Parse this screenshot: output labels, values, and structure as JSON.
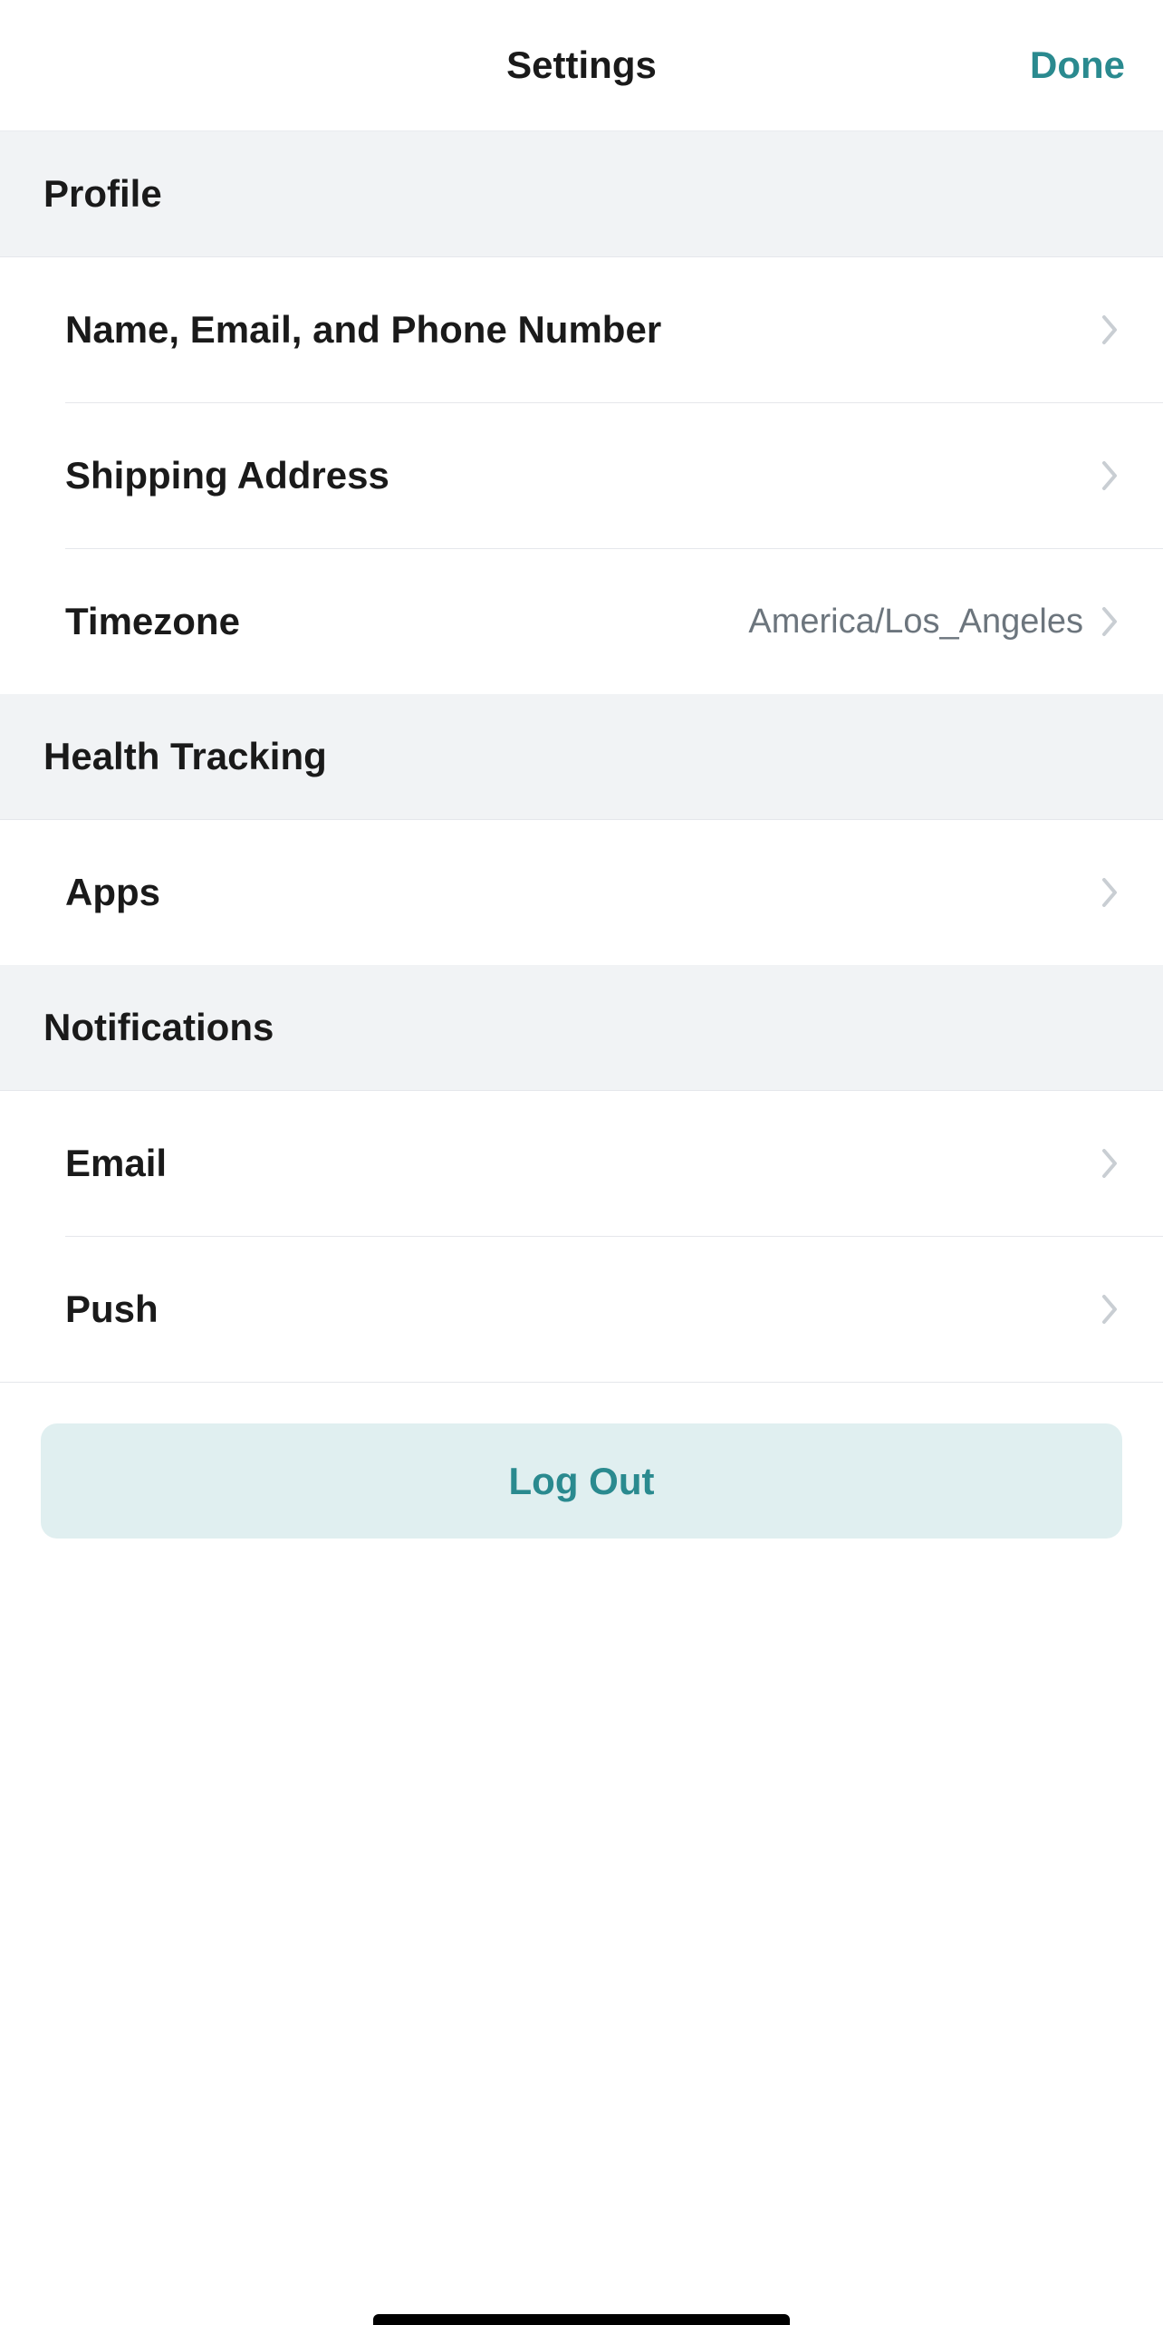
{
  "nav": {
    "title": "Settings",
    "done": "Done"
  },
  "sections": {
    "profile": {
      "title": "Profile",
      "rows": {
        "nameEmailPhone": {
          "label": "Name, Email, and Phone Number"
        },
        "shipping": {
          "label": "Shipping Address"
        },
        "timezone": {
          "label": "Timezone",
          "value": "America/Los_Angeles"
        }
      }
    },
    "healthTracking": {
      "title": "Health Tracking",
      "rows": {
        "apps": {
          "label": "Apps"
        }
      }
    },
    "notifications": {
      "title": "Notifications",
      "rows": {
        "email": {
          "label": "Email"
        },
        "push": {
          "label": "Push"
        }
      }
    }
  },
  "logout": {
    "label": "Log Out"
  }
}
